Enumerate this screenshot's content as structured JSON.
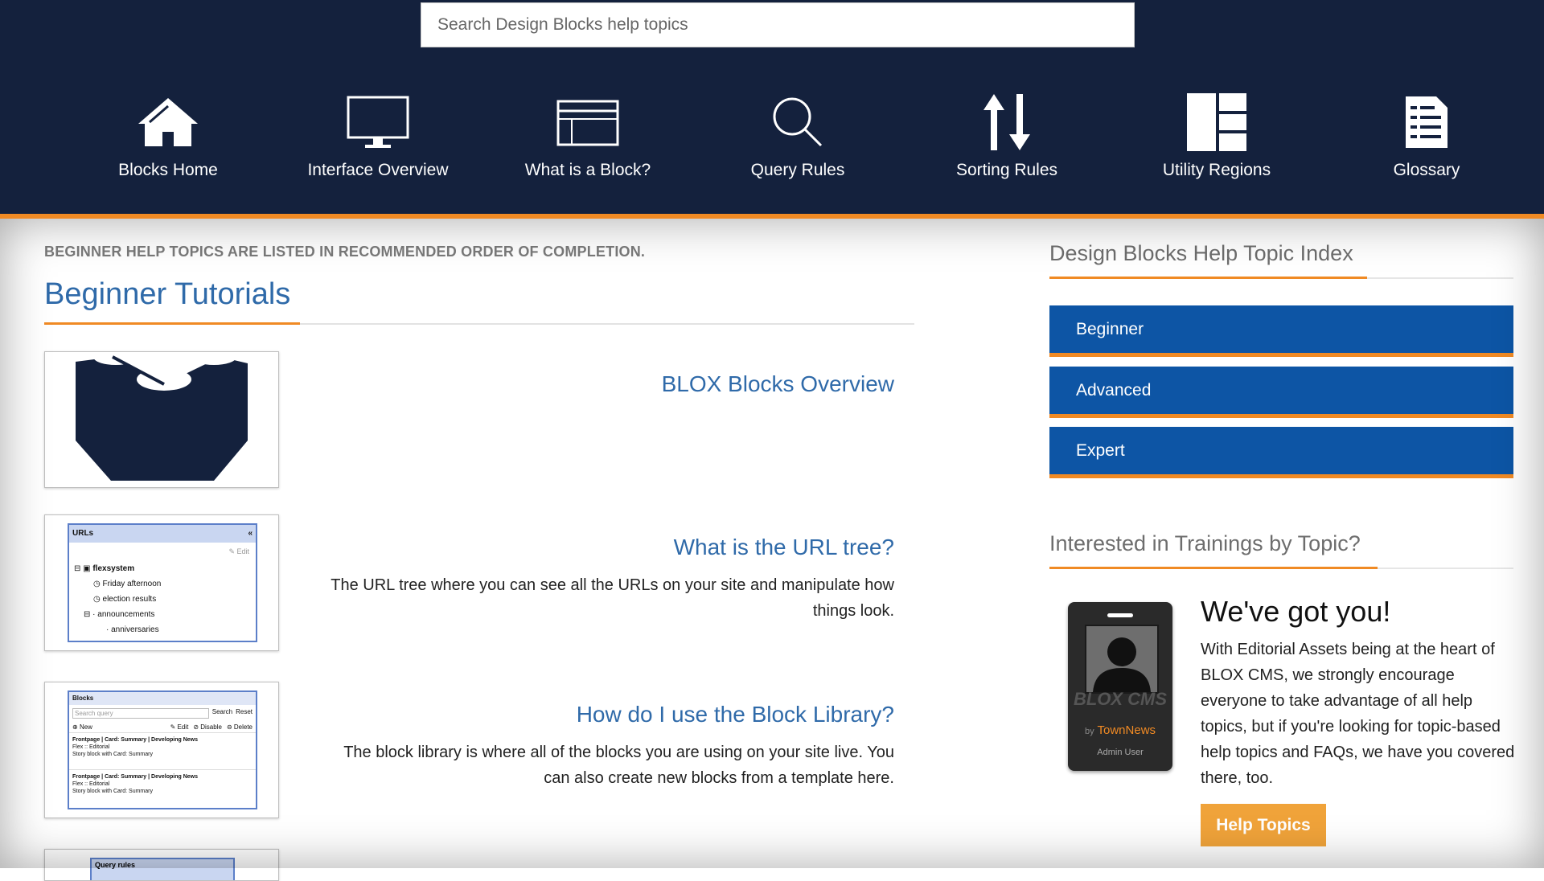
{
  "search": {
    "placeholder": "Search Design Blocks help topics"
  },
  "nav": [
    {
      "label": "Blocks Home",
      "icon": "home-icon"
    },
    {
      "label": "Interface Overview",
      "icon": "monitor-icon"
    },
    {
      "label": "What is a Block?",
      "icon": "window-icon"
    },
    {
      "label": "Query Rules",
      "icon": "search-icon"
    },
    {
      "label": "Sorting Rules",
      "icon": "sort-arrows-icon"
    },
    {
      "label": "Utility Regions",
      "icon": "layout-regions-icon"
    },
    {
      "label": "Glossary",
      "icon": "document-list-icon"
    }
  ],
  "main": {
    "intro": "BEGINNER HELP TOPICS ARE LISTED IN RECOMMENDED ORDER OF COMPLETION.",
    "title": "Beginner Tutorials",
    "tutorials": [
      {
        "title": "BLOX Blocks Overview",
        "desc": ""
      },
      {
        "title": "What is the URL tree?",
        "desc": "The URL tree where you can see all the URLs on your site and manipulate how things look."
      },
      {
        "title": "How do I use the Block Library?",
        "desc": "The block library is where all of the blocks you are using on your site live. You can also create new blocks from a template here."
      }
    ],
    "thumb_url": {
      "header": "URLs",
      "edit": "Edit",
      "items": [
        "flexsystem",
        "Friday afternoon",
        "election results",
        "announcements",
        "anniversaries"
      ]
    },
    "thumb_blocks": {
      "header": "Blocks",
      "search_placeholder": "Search query",
      "search_btn": "Search",
      "reset_btn": "Reset",
      "new_btn": "New",
      "edit_btn": "Edit",
      "disable_btn": "Disable",
      "delete_btn": "Delete",
      "row1_title": "Frontpage | Card: Summary | Developing News",
      "row1_sub": "Flex :: Editorial",
      "row1_desc": "Story block with Card: Summary",
      "row2_title": "Frontpage | Card: Summary | Developing News",
      "row2_sub": "Flex :: Editorial",
      "row2_desc": "Story block with Card: Summary"
    },
    "thumb_query": {
      "header": "Query rules"
    }
  },
  "sidebar": {
    "index_title": "Design Blocks Help Topic Index",
    "levels": [
      "Beginner",
      "Advanced",
      "Expert"
    ],
    "training_title": "Interested in Trainings by Topic?",
    "badge_brand": "BLOX CMS",
    "badge_by": "by",
    "badge_news": "TownNews",
    "badge_user": "Admin User",
    "promo_title": "We've got you!",
    "promo_text": "With Editorial Assets being at the heart of BLOX CMS, we strongly encourage everyone to take advantage of all help topics, but if you're looking for topic-based help topics and FAQs, we have you covered there, too.",
    "cta": "Help Topics"
  },
  "colors": {
    "header_bg": "#14213d",
    "accent": "#f08a24",
    "link": "#2f6aa9",
    "button_bg": "#0d55a5",
    "cta_bg": "#f0a33a"
  }
}
